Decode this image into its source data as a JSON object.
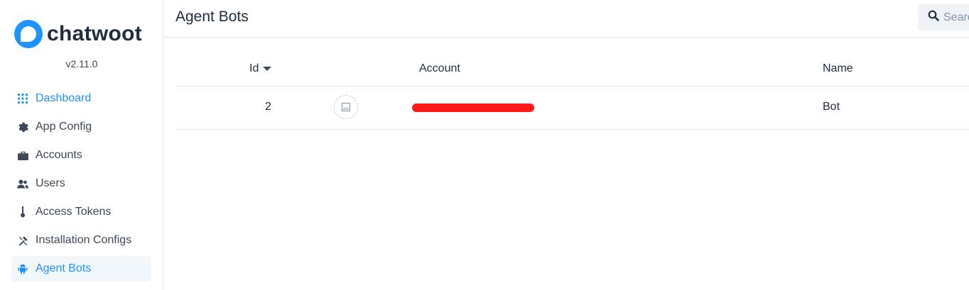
{
  "app": {
    "brand_name": "chatwoot",
    "version": "v2.11.0"
  },
  "sidebar": {
    "items": [
      {
        "label": "Dashboard",
        "icon": "grid-icon"
      },
      {
        "label": "App Config",
        "icon": "gear-icon"
      },
      {
        "label": "Accounts",
        "icon": "briefcase-icon"
      },
      {
        "label": "Users",
        "icon": "users-icon"
      },
      {
        "label": "Access Tokens",
        "icon": "key-icon"
      },
      {
        "label": "Installation Configs",
        "icon": "tools-icon"
      },
      {
        "label": "Agent Bots",
        "icon": "android-icon"
      }
    ],
    "active_item": "Agent Bots"
  },
  "header": {
    "title": "Agent Bots",
    "search_placeholder": "Search"
  },
  "table": {
    "columns": [
      "Id",
      "Account",
      "Name"
    ],
    "sort_column": "Id",
    "sort_direction": "descending",
    "rows": [
      {
        "id": "2",
        "account": "[redacted]",
        "name": "Bot"
      }
    ]
  },
  "colors": {
    "accent": "#1f93ff",
    "redaction": "#ff1a1a",
    "selected_bg": "#f2f7fc"
  }
}
